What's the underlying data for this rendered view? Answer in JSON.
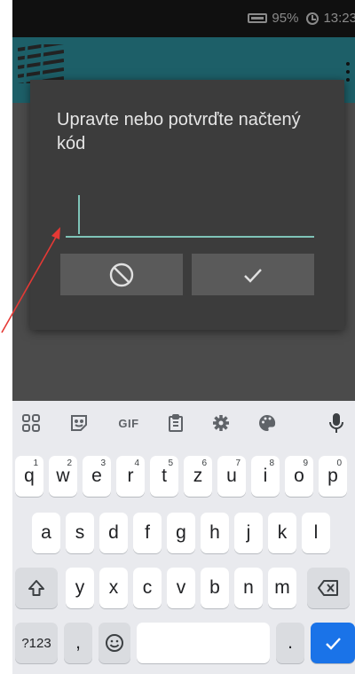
{
  "status_bar": {
    "battery": "95%",
    "time": "13:23"
  },
  "dialog": {
    "title": "Upravte nebo potvrďte načtený kód",
    "input_value": ""
  },
  "colors": {
    "accent": "#7fc4b8",
    "dialog_bg": "#3c3c3c",
    "enter_key": "#1a73e8"
  },
  "keyboard": {
    "toolbar": [
      "apps-grid-icon",
      "sticker-icon",
      "GIF",
      "clipboard-icon",
      "settings-icon",
      "palette-icon",
      "mic-icon"
    ],
    "rows": [
      [
        {
          "label": "q",
          "hint": "1"
        },
        {
          "label": "w",
          "hint": "2"
        },
        {
          "label": "e",
          "hint": "3"
        },
        {
          "label": "r",
          "hint": "4"
        },
        {
          "label": "t",
          "hint": "5"
        },
        {
          "label": "z",
          "hint": "6"
        },
        {
          "label": "u",
          "hint": "7"
        },
        {
          "label": "i",
          "hint": "8"
        },
        {
          "label": "o",
          "hint": "9"
        },
        {
          "label": "p",
          "hint": "0"
        }
      ],
      [
        {
          "label": "a"
        },
        {
          "label": "s"
        },
        {
          "label": "d"
        },
        {
          "label": "f"
        },
        {
          "label": "g"
        },
        {
          "label": "h"
        },
        {
          "label": "j"
        },
        {
          "label": "k"
        },
        {
          "label": "l"
        }
      ],
      [
        {
          "label": "y"
        },
        {
          "label": "x"
        },
        {
          "label": "c"
        },
        {
          "label": "v"
        },
        {
          "label": "b"
        },
        {
          "label": "n"
        },
        {
          "label": "m"
        }
      ]
    ],
    "symbols_key": "?123",
    "comma_key": ",",
    "period_key": "."
  }
}
